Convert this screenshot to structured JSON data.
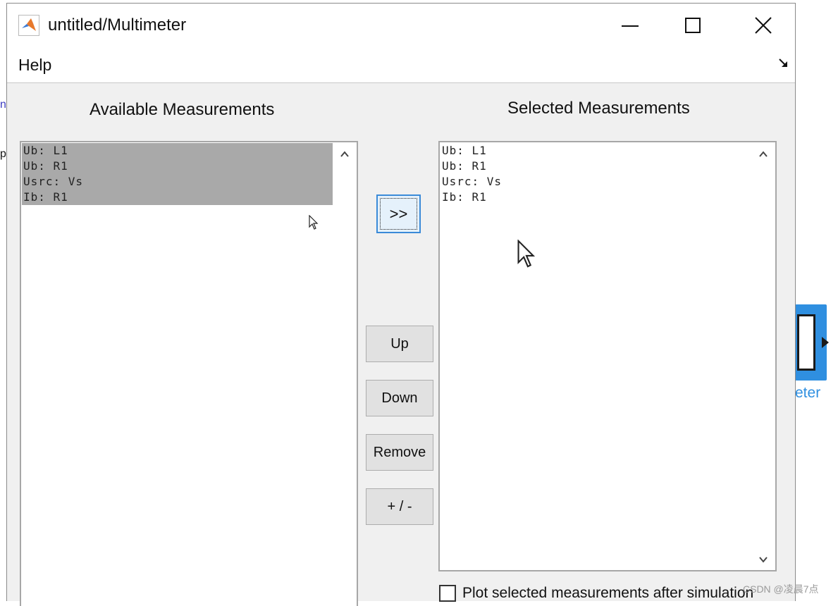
{
  "window": {
    "title": "untitled/Multimeter",
    "icon": "matlab-logo-icon"
  },
  "menu": {
    "items": [
      "Help"
    ]
  },
  "available": {
    "title": "Available Measurements",
    "items": [
      "Ub: L1",
      "Ub: R1",
      "Usrc: Vs",
      "Ib: R1"
    ]
  },
  "selected": {
    "title": "Selected Measurements",
    "items": [
      "Ub: L1",
      "Ub: R1",
      "Usrc: Vs",
      "Ib: R1"
    ]
  },
  "buttons": {
    "add": ">>",
    "up": "Up",
    "down": "Down",
    "remove": "Remove",
    "plusminus": "+ / -"
  },
  "plot_option": {
    "label": "Plot selected measurements after simulation",
    "checked": false
  },
  "background": {
    "block_label": "eter",
    "fragment_1": "n",
    "fragment_2": "p"
  },
  "watermark": "CSDN @凌晨7点",
  "colors": {
    "focus_border": "#3a8ad8",
    "selection": "#a9a9a9",
    "block_blue": "#2f8fe0"
  }
}
